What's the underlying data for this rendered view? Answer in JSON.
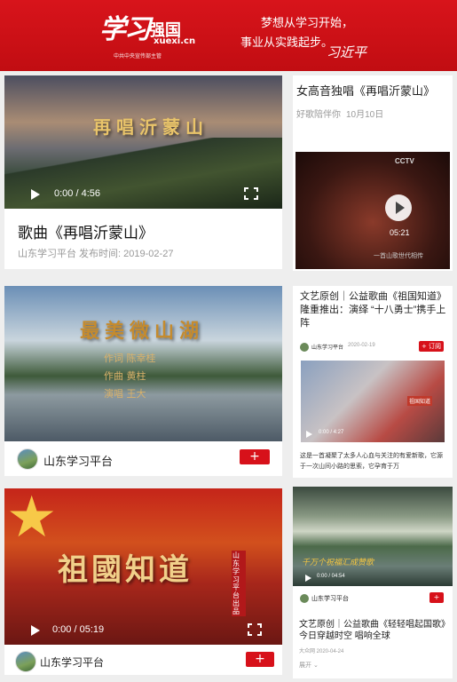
{
  "header": {
    "logo_text": "学习",
    "logo_suffix": "强国",
    "logo_url": "xuexi.cn",
    "logo_sub": "中共中央宣传部主管",
    "slogan_line1": "梦想从学习开始，",
    "slogan_line2": "事业从实践起步。",
    "signature": "习近平"
  },
  "card1": {
    "overlay_title": "再唱沂蒙山",
    "time": "0:00 / 4:56",
    "title": "歌曲《再唱沂蒙山》",
    "meta": "山东学习平台 发布时间: 2019-02-27"
  },
  "card2": {
    "title": "女高音独唱《再唱沂蒙山》",
    "source": "好歌陪伴你",
    "date": "10月10日",
    "video_logo": "CCTV",
    "duration": "05:21",
    "video_caption": "一首山歌世代相传"
  },
  "card3": {
    "overlay_title": "最美微山湖",
    "credit1": "作词 陈幸桂",
    "credit2": "作曲 黄柱",
    "credit3": "演唱 王大",
    "account": "山东学习平台",
    "follow": "+"
  },
  "card4": {
    "title": "文艺原创｜公益歌曲《祖国知道》隆重推出：演绎 “十八勇士”携手上阵",
    "account": "山东学习平台",
    "date": "2020-02-19",
    "subscribe": "+ 订阅",
    "video_banner": "祖国知道",
    "time": "0:00 / 4:27",
    "desc": "这是一首凝聚了太多人心血与关注的有爱新歌，它源于一次山间小路的思索，它孕育于万"
  },
  "card5": {
    "overlay_title": "祖國知道",
    "badge": "山东学习平台出品",
    "time": "0:00 / 05:19",
    "account": "山东学习平台",
    "follow": "+"
  },
  "card6": {
    "video_text": "千万个祝福汇成赞歌",
    "time": "0:00 / 04:54",
    "account": "山东学习平台",
    "follow": "+",
    "title": "文艺原创｜公益歌曲《轻轻唱起国歌》今日穿越时空 唱响全球",
    "meta": "大众网 2020-04-24",
    "expand": "展开 ⌄"
  }
}
